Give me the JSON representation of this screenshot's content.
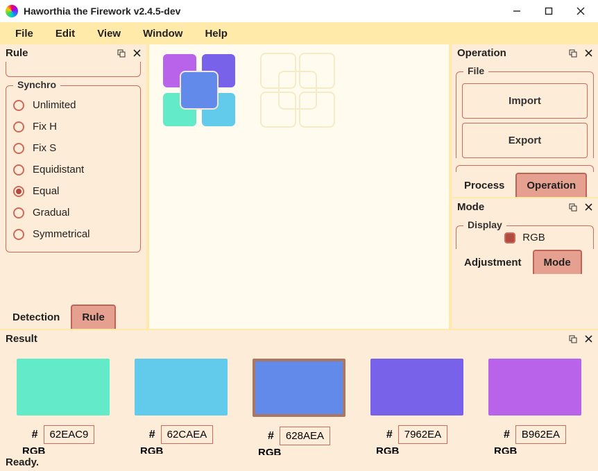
{
  "window": {
    "title": "Haworthia the Firework v2.4.5-dev"
  },
  "menubar": [
    "File",
    "Edit",
    "View",
    "Window",
    "Help"
  ],
  "rule_panel": {
    "title": "Rule",
    "synchro_legend": "Synchro",
    "synchro_options": [
      "Unlimited",
      "Fix H",
      "Fix S",
      "Equidistant",
      "Equal",
      "Gradual",
      "Symmetrical"
    ],
    "synchro_selected": "Equal",
    "tabs": [
      "Detection",
      "Rule"
    ],
    "active_tab": "Rule"
  },
  "wheel_colors": {
    "tl": "#b962ea",
    "tr": "#7962ea",
    "bl": "#62eac9",
    "br": "#62caea",
    "ctr": "#628aea"
  },
  "operation_panel": {
    "title": "Operation",
    "file_legend": "File",
    "buttons": [
      "Import",
      "Export"
    ],
    "tabs": [
      "Process",
      "Operation"
    ],
    "active_tab": "Operation"
  },
  "mode_panel": {
    "title": "Mode",
    "display_legend": "Display",
    "display_option": "RGB",
    "tabs": [
      "Adjustment",
      "Mode"
    ],
    "active_tab": "Mode"
  },
  "result_panel": {
    "title": "Result",
    "swatches": [
      {
        "color": "#62eac9",
        "hex": "62EAC9"
      },
      {
        "color": "#62caea",
        "hex": "62CAEA"
      },
      {
        "color": "#628aea",
        "hex": "628AEA",
        "selected": true
      },
      {
        "color": "#7962ea",
        "hex": "7962EA"
      },
      {
        "color": "#b962ea",
        "hex": "B962EA"
      }
    ],
    "cut_label": "RGB"
  },
  "status": "Ready."
}
